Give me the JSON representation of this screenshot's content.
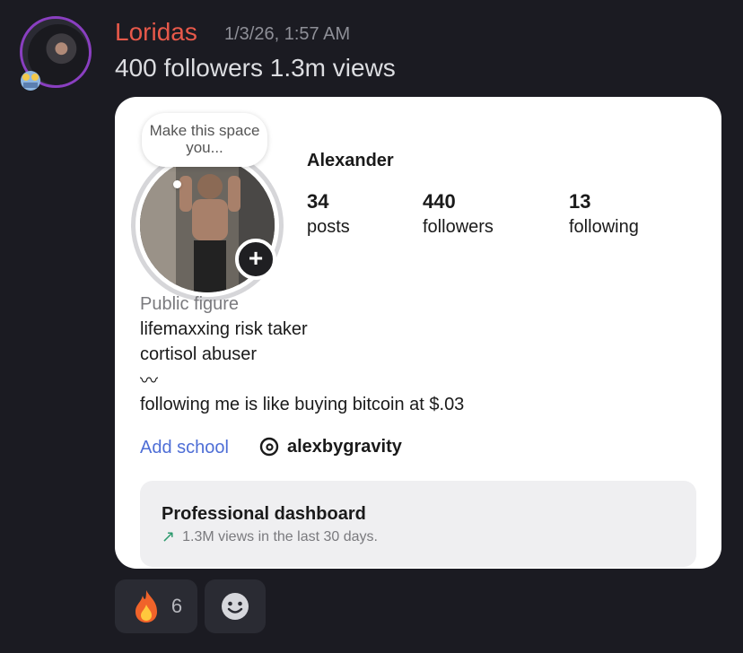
{
  "message": {
    "author": "Loridas",
    "timestamp": "1/3/26, 1:57 AM",
    "text": "400 followers 1.3m views",
    "author_color": "#e8594a"
  },
  "profile_card": {
    "bubble_text": "Make this space you...",
    "name": "Alexander",
    "stats": [
      {
        "value": "34",
        "label": "posts"
      },
      {
        "value": "440",
        "label": "followers"
      },
      {
        "value": "13",
        "label": "following"
      }
    ],
    "category": "Public figure",
    "bio": [
      "lifemaxxing risk taker",
      "cortisol abuser",
      "〰",
      "following me is like buying bitcoin at $.03"
    ],
    "add_school": "Add school",
    "threads_handle": "alexbygravity",
    "dashboard": {
      "title": "Professional dashboard",
      "subtitle": "1.3M views in the last 30 days."
    },
    "link_color": "#4e6ed6"
  },
  "reactions": [
    {
      "icon": "fire-emoji-icon",
      "count": "6"
    },
    {
      "icon": "add-reaction-smile-icon"
    }
  ]
}
